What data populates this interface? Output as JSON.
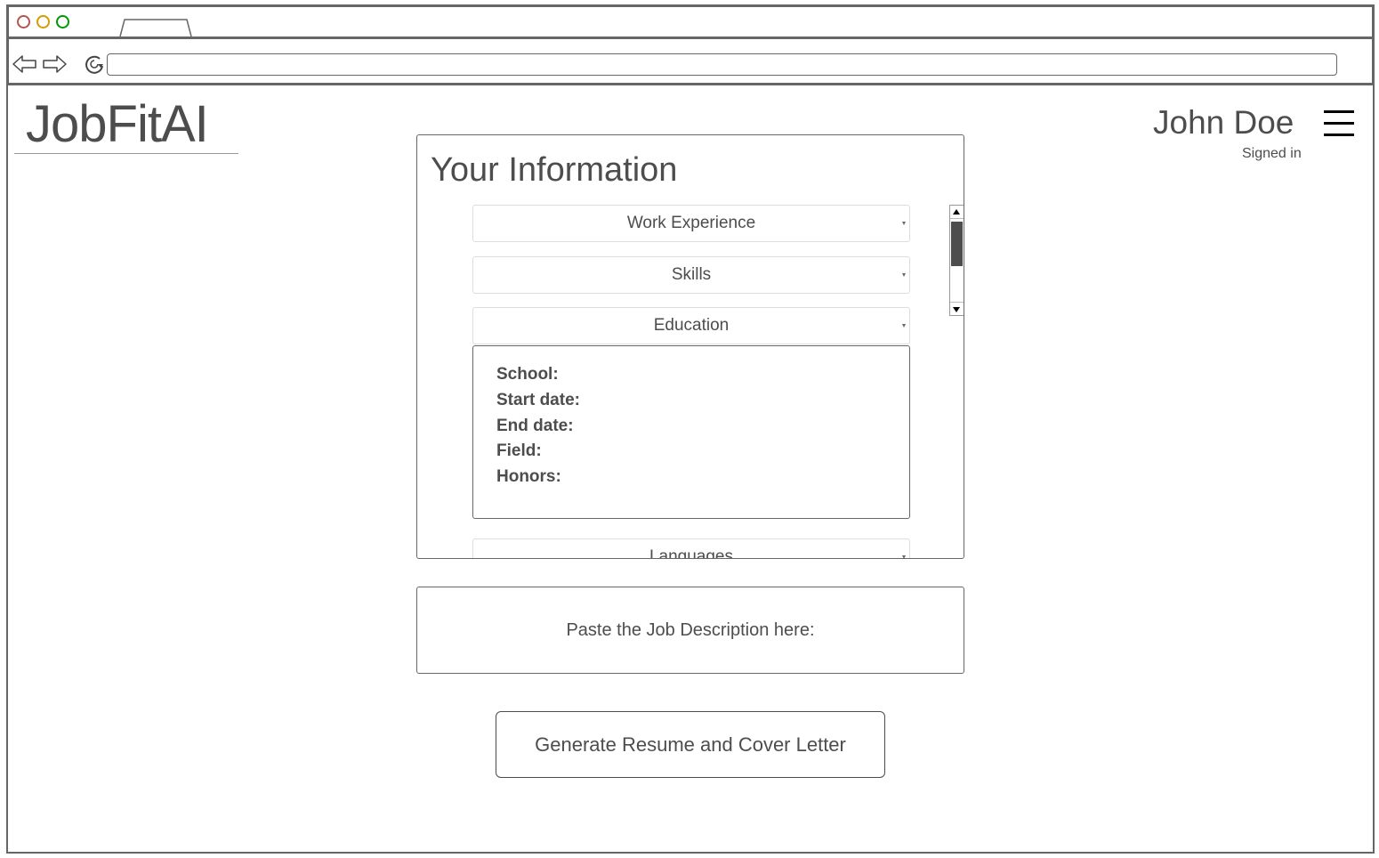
{
  "app": {
    "logo": "JobFitAI"
  },
  "user": {
    "name": "John Doe",
    "status": "Signed in"
  },
  "info_panel": {
    "title": "Your Information",
    "sections": {
      "work_experience": "Work Experience",
      "skills": "Skills",
      "education": "Education",
      "languages": "Languages"
    },
    "education_fields": {
      "school": "School:",
      "start_date": "Start date:",
      "end_date": "End date:",
      "field": "Field:",
      "honors": "Honors:"
    }
  },
  "job_description": {
    "placeholder": "Paste the Job Description here:"
  },
  "actions": {
    "generate": "Generate Resume and Cover Letter"
  },
  "colors": {
    "text": "#4d4d4d",
    "border": "#666666",
    "close_dot": "#b85450",
    "minimize_dot": "#d79b00",
    "maximize_dot": "#009900"
  },
  "icons": {
    "back": "back-arrow-icon",
    "forward": "forward-arrow-icon",
    "reload": "reload-icon",
    "menu": "hamburger-menu-icon",
    "dropdown": "chevron-down-icon"
  }
}
